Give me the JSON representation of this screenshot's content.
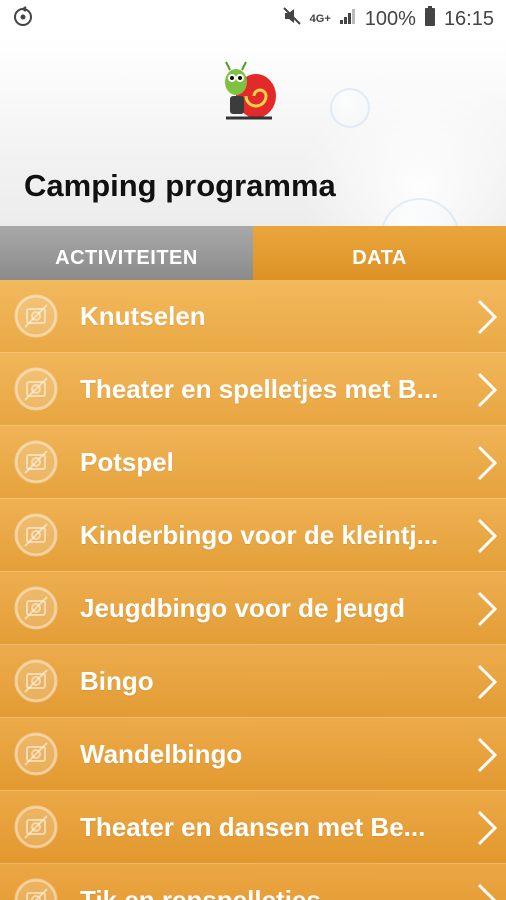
{
  "statusbar": {
    "network_label": "4G+",
    "battery": "100%",
    "time": "16:15"
  },
  "header": {
    "title": "Camping programma"
  },
  "tabs": [
    {
      "label": "ACTIVITEITEN",
      "active": true
    },
    {
      "label": "DATA",
      "active": false
    }
  ],
  "activities": [
    {
      "label": "Knutselen"
    },
    {
      "label": "Theater en spelletjes met B..."
    },
    {
      "label": "Potspel"
    },
    {
      "label": "Kinderbingo voor de kleintj..."
    },
    {
      "label": "Jeugdbingo voor de jeugd"
    },
    {
      "label": "Bingo"
    },
    {
      "label": "Wandelbingo"
    },
    {
      "label": "Theater en dansen met Be..."
    },
    {
      "label": "Tik en renspelletjes"
    }
  ],
  "colors": {
    "accent_orange": "#e99c2e",
    "tab_active_grey": "#9a9a9a",
    "text_white": "#ffffff"
  }
}
